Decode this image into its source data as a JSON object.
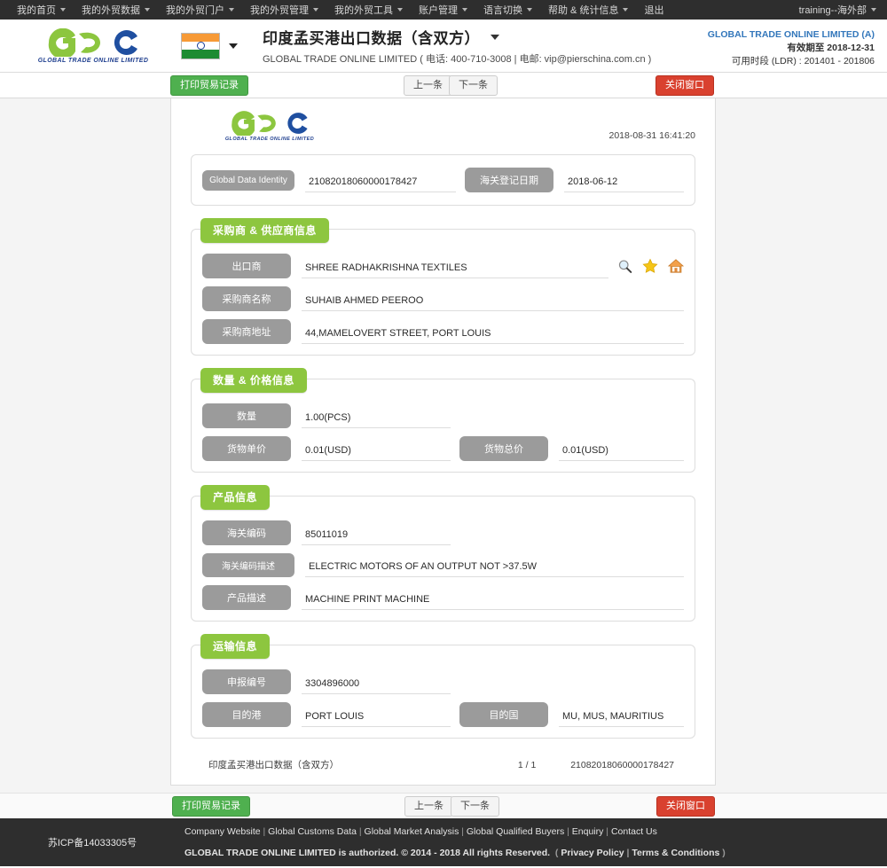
{
  "topnav": {
    "items": [
      {
        "label": "我的首页",
        "caret": true
      },
      {
        "label": "我的外贸数据",
        "caret": true
      },
      {
        "label": "我的外贸门户",
        "caret": true
      },
      {
        "label": "我的外贸管理",
        "caret": true
      },
      {
        "label": "我的外贸工具",
        "caret": true
      },
      {
        "label": "账户管理",
        "caret": true
      },
      {
        "label": "语言切换",
        "caret": true
      },
      {
        "label": "帮助 & 统计信息",
        "caret": true
      },
      {
        "label": "退出",
        "caret": false
      }
    ],
    "user": "training--海外部"
  },
  "header": {
    "logo_text": "GTC",
    "logo_sub": "GLOBAL TRADE  ONLINE LIMITED",
    "flag": "india-flag",
    "title": "印度孟买港出口数据（含双方）",
    "subtitle": "GLOBAL TRADE ONLINE LIMITED ( 电话:   400-710-3008 | 电邮:  vip@pierschina.com.cn )",
    "account_name": "GLOBAL TRADE ONLINE LIMITED (A)",
    "valid_label": "有效期至",
    "valid_date": "2018-12-31",
    "range_text": "可用时段 (LDR) : 201401 - 201806"
  },
  "toolbar": {
    "print_label": "打印贸易记录",
    "prev_label": "上一条",
    "next_label": "下一条",
    "close_label": "关闭窗口"
  },
  "document": {
    "logo_text": "GTC",
    "logo_sub": "GLOBAL TRADE  ONLINE LIMITED",
    "timestamp": "2018-08-31 16:41:20",
    "identity": {
      "id_label": "Global Data Identity",
      "id_value": "21082018060000178427",
      "date_label": "海关登记日期",
      "date_value": "2018-06-12"
    },
    "sections": [
      {
        "title": "采购商 & 供应商信息",
        "rows": [
          {
            "label": "出口商",
            "value": "SHREE RADHAKRISHNA TEXTILES",
            "icons": [
              "search-icon",
              "star-icon",
              "home-icon"
            ]
          },
          {
            "label": "采购商名称",
            "value": "SUHAIB AHMED PEEROO"
          },
          {
            "label": "采购商地址",
            "value": "44,MAMELOVERT STREET, PORT LOUIS"
          }
        ]
      },
      {
        "title": "数量 & 价格信息",
        "rows": [
          {
            "label": "数量",
            "value": "1.00(PCS)",
            "short": true
          },
          {
            "label": "货物单价",
            "value": "0.01(USD)",
            "short": true,
            "label2": "货物总价",
            "value2": "0.01(USD)"
          }
        ]
      },
      {
        "title": "产品信息",
        "rows": [
          {
            "label": "海关编码",
            "value": "85011019",
            "short": true
          },
          {
            "label": "海关编码描述",
            "value": "ELECTRIC MOTORS OF AN OUTPUT NOT >37.5W"
          },
          {
            "label": "产品描述",
            "value": "MACHINE PRINT MACHINE"
          }
        ]
      },
      {
        "title": "运输信息",
        "rows": [
          {
            "label": "申报编号",
            "value": "3304896000",
            "short": true
          },
          {
            "label": "目的港",
            "value": "PORT LOUIS",
            "short": true,
            "label2": "目的国",
            "value2": "MU, MUS, MAURITIUS"
          }
        ]
      }
    ],
    "footer": {
      "name": "印度孟买港出口数据（含双方）",
      "page": "1 / 1",
      "id": "21082018060000178427"
    }
  },
  "sitefooter": {
    "icp": "苏ICP备14033305号",
    "links": [
      "Company Website",
      "Global Customs Data",
      "Global Market Analysis",
      "Global Qualified Buyers",
      "Enquiry",
      "Contact Us"
    ],
    "copyright": "GLOBAL TRADE ONLINE LIMITED is authorized. © 2014 - 2018 All rights Reserved.",
    "legal_links": [
      "Privacy Policy",
      "Terms & Conditions"
    ]
  },
  "colors": {
    "nav_bg": "#2e2e2e",
    "section_green": "#8dc63f",
    "pill_gray": "#9b9b9b",
    "btn_green": "#4fb04f",
    "btn_red": "#d9412f",
    "accent_blue": "#3377bb"
  }
}
